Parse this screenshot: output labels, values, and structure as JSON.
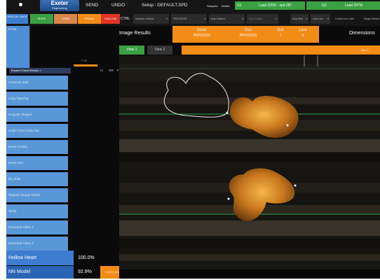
{
  "topbar": {
    "logo": "Exeter",
    "logo_sub": "Engineering",
    "send": "SEND",
    "undo": "UNDO",
    "setup": "Setup : DEFAULT.SPD",
    "samples": "Samples",
    "delete": "Delete",
    "g1": "G1",
    "load1": "Load 220% : spd 287",
    "g2": "G2",
    "load2": "Load 247%"
  },
  "bar2": {
    "special_pack": "SPECIAL PACK",
    "chips": [
      "SKIPS",
      "CSSG",
      "FRADD",
      "HOLLOW"
    ],
    "ctrl": "CTRL",
    "dropdowns": [
      "Sample Defect",
      "PROCESS",
      "Any Defect",
      "Any Image",
      "Any Belt",
      "Any Lan"
    ],
    "continuous": "Continuous Latch",
    "single": "Single Default"
  },
  "left": {
    "top_label": "97.9%",
    "pct": "7.7%",
    "expand": "Expand Grade Breaks",
    "cols": [
      "LI",
      "GR",
      "FL"
    ],
    "defects": [
      "Greenish Side",
      "Long Tapering",
      "Irregular Shaped",
      "Under 7cm Cross Grp",
      "Brown Rotary",
      "Brown Dry",
      "Dry Side",
      "Ripped / Rough Defect",
      "White",
      "Reversed Class 1",
      "Reversed Class 2"
    ],
    "hollow_heart": "Hollow Heart",
    "hollow_value": "100.0%",
    "nn_model": "NN Model",
    "nn_value": "92.9%",
    "nn_bar": "0.0 0.0 0.0"
  },
  "results": {
    "title": "Image Results",
    "grade_label": "Grade",
    "grade_value": "PROCESS",
    "size_label": "Size",
    "size_value": "PROCESS",
    "belt_label": "Belt",
    "belt_value": "1",
    "lane_label": "Lane",
    "lane_value": "9",
    "dimensions": "Dimensions",
    "view1": "View 1",
    "view2": "View 2",
    "size_bar_label": "Size 1"
  },
  "colors": {
    "orange": "#f28c17",
    "green": "#3aa043",
    "blue": "#5a97d8",
    "red": "#e03325"
  }
}
